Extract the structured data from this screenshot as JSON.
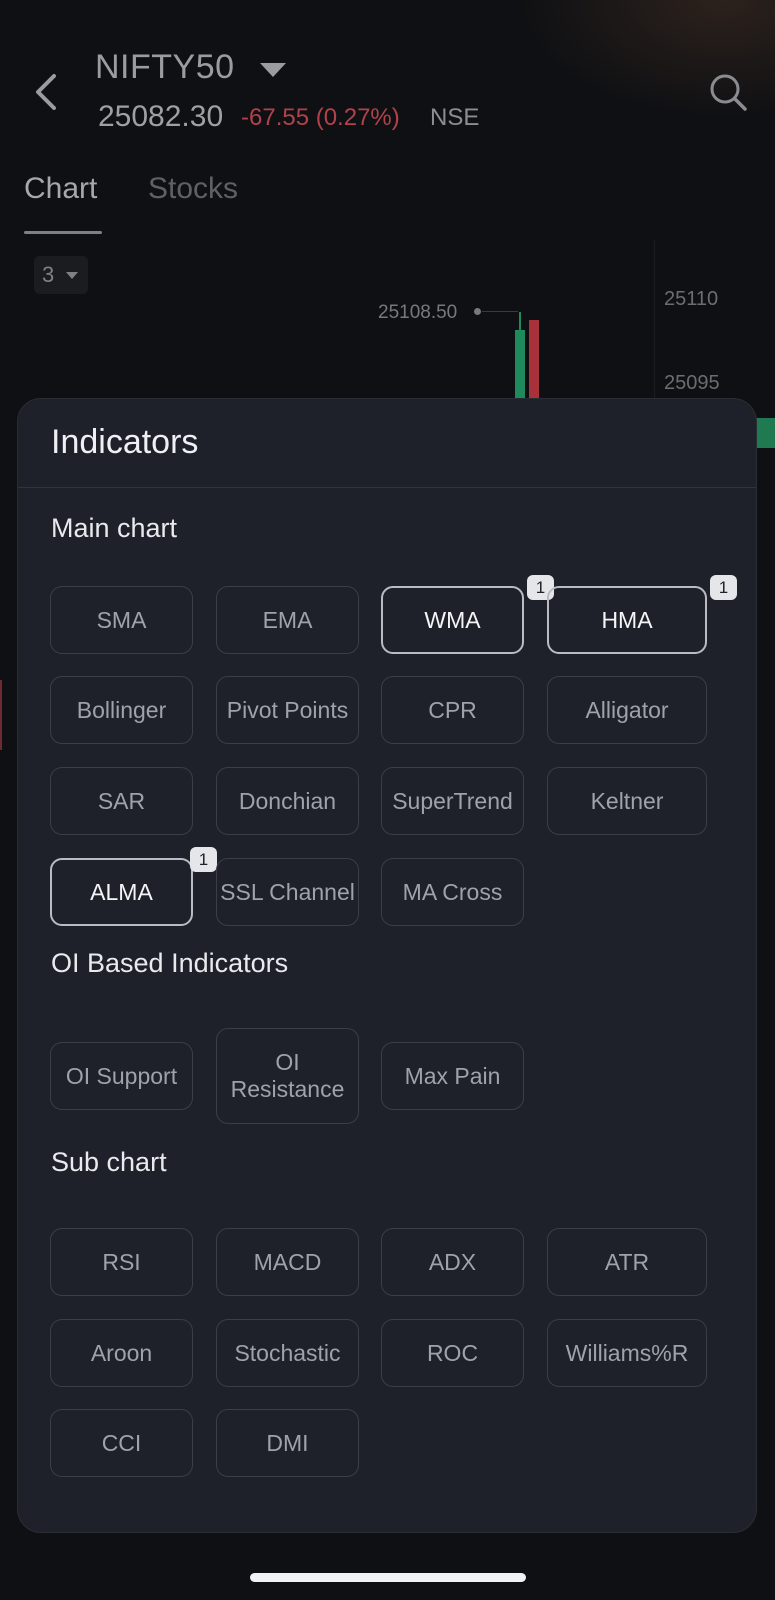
{
  "header": {
    "symbol": "NIFTY50",
    "price": "25082.30",
    "change": "-67.55 (0.27%)",
    "exchange": "NSE"
  },
  "tabs": [
    {
      "label": "Chart",
      "active": true
    },
    {
      "label": "Stocks",
      "active": false
    }
  ],
  "chart": {
    "interval": "3",
    "high_label": "25108.50",
    "axis": [
      "25110",
      "25095"
    ]
  },
  "sheet": {
    "title": "Indicators",
    "sections": [
      {
        "title": "Main chart",
        "items": [
          {
            "label": "SMA",
            "selected": false
          },
          {
            "label": "EMA",
            "selected": false
          },
          {
            "label": "WMA",
            "selected": true,
            "badge": "1"
          },
          {
            "label": "HMA",
            "selected": true,
            "badge": "1"
          },
          {
            "label": "Bollinger",
            "selected": false
          },
          {
            "label": "Pivot Points",
            "selected": false
          },
          {
            "label": "CPR",
            "selected": false
          },
          {
            "label": "Alligator",
            "selected": false
          },
          {
            "label": "SAR",
            "selected": false
          },
          {
            "label": "Donchian",
            "selected": false
          },
          {
            "label": "SuperTrend",
            "selected": false
          },
          {
            "label": "Keltner",
            "selected": false
          },
          {
            "label": "ALMA",
            "selected": true,
            "badge": "1"
          },
          {
            "label": "SSL Channel",
            "selected": false
          },
          {
            "label": "MA Cross",
            "selected": false
          }
        ]
      },
      {
        "title": "OI Based Indicators",
        "items": [
          {
            "label": "OI Support",
            "selected": false
          },
          {
            "label": "OI Resistance",
            "selected": false
          },
          {
            "label": "Max Pain",
            "selected": false
          }
        ]
      },
      {
        "title": "Sub chart",
        "items": [
          {
            "label": "RSI",
            "selected": false
          },
          {
            "label": "MACD",
            "selected": false
          },
          {
            "label": "ADX",
            "selected": false
          },
          {
            "label": "ATR",
            "selected": false
          },
          {
            "label": "Aroon",
            "selected": false
          },
          {
            "label": "Stochastic",
            "selected": false
          },
          {
            "label": "ROC",
            "selected": false
          },
          {
            "label": "Williams%R",
            "selected": false
          },
          {
            "label": "CCI",
            "selected": false
          },
          {
            "label": "DMI",
            "selected": false
          }
        ]
      }
    ]
  },
  "colors": {
    "negative": "#b1424a",
    "positive": "#1f8a5b",
    "sheet_bg": "#1e2129"
  }
}
